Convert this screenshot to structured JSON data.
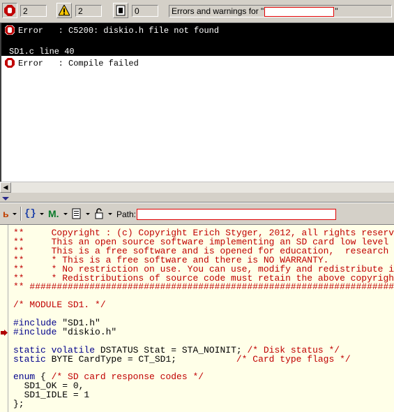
{
  "toolbar": {
    "errors_count": "2",
    "warnings_count": "2",
    "info_count": "0",
    "filter_prefix": "Errors and warnings for \"",
    "filter_suffix": "\"",
    "icons": [
      "error-filter-icon",
      "warning-filter-icon",
      "info-filter-icon"
    ]
  },
  "messages": [
    {
      "kind": "Error",
      "text": "Error   : C5200: diskio.h file not found",
      "detail": "SD1.c line 40",
      "selected": true
    },
    {
      "kind": "Error",
      "text": "Error   : Compile failed",
      "detail": "",
      "selected": false
    }
  ],
  "editor_toolbar": {
    "path_label": "Path:",
    "icons": [
      "marker-icon",
      "braces-icon",
      "macro-icon",
      "document-list-icon",
      "lock-icon"
    ]
  },
  "code": {
    "lines": [
      {
        "parts": [
          [
            "c-comment",
            "**     Copyright : (c) Copyright Erich Styger, 2012, all rights reserved."
          ]
        ]
      },
      {
        "parts": [
          [
            "c-comment",
            "**     This an open source software implementing an SD card low level driver"
          ]
        ]
      },
      {
        "parts": [
          [
            "c-comment",
            "**     This is a free software and is opened for education,  research and commercial developments"
          ]
        ]
      },
      {
        "parts": [
          [
            "c-comment",
            "**     * This is a free software and there is NO WARRANTY."
          ]
        ]
      },
      {
        "parts": [
          [
            "c-comment",
            "**     * No restriction on use. You can use, modify and redistribute it for"
          ]
        ]
      },
      {
        "parts": [
          [
            "c-comment",
            "**     * Redistributions of source code must retain the above copyright notice."
          ]
        ]
      },
      {
        "parts": [
          [
            "c-comment",
            "** ###################################################################*/"
          ]
        ]
      },
      {
        "parts": []
      },
      {
        "parts": [
          [
            "c-comment",
            "/* MODULE SD1. */"
          ]
        ]
      },
      {
        "parts": []
      },
      {
        "parts": [
          [
            "c-kw",
            "#include"
          ],
          [
            "c-str",
            " \"SD1.h\""
          ]
        ]
      },
      {
        "parts": [
          [
            "c-kw",
            "#include"
          ],
          [
            "c-str",
            " \"diskio.h\""
          ]
        ]
      },
      {
        "parts": []
      },
      {
        "parts": [
          [
            "c-kw",
            "static volatile"
          ],
          [
            "c-plain",
            " DSTATUS Stat = STA_NOINIT; "
          ],
          [
            "c-comment",
            "/* Disk status */"
          ]
        ]
      },
      {
        "parts": [
          [
            "c-kw",
            "static"
          ],
          [
            "c-plain",
            " BYTE CardType = CT_SD1;           "
          ],
          [
            "c-comment",
            "/* Card type flags */"
          ]
        ]
      },
      {
        "parts": []
      },
      {
        "parts": [
          [
            "c-kw",
            "enum"
          ],
          [
            "c-plain",
            " { "
          ],
          [
            "c-comment",
            "/* SD card response codes */"
          ]
        ]
      },
      {
        "parts": [
          [
            "c-plain",
            "  SD1_OK = 0,"
          ]
        ]
      },
      {
        "parts": [
          [
            "c-plain",
            "  SD1_IDLE = 1"
          ]
        ]
      },
      {
        "parts": [
          [
            "c-plain",
            "};"
          ]
        ]
      }
    ]
  },
  "colors": {
    "selection": "#000000",
    "comment": "#c00000",
    "keyword": "#00008b",
    "editor_bg": "#ffffe8"
  }
}
